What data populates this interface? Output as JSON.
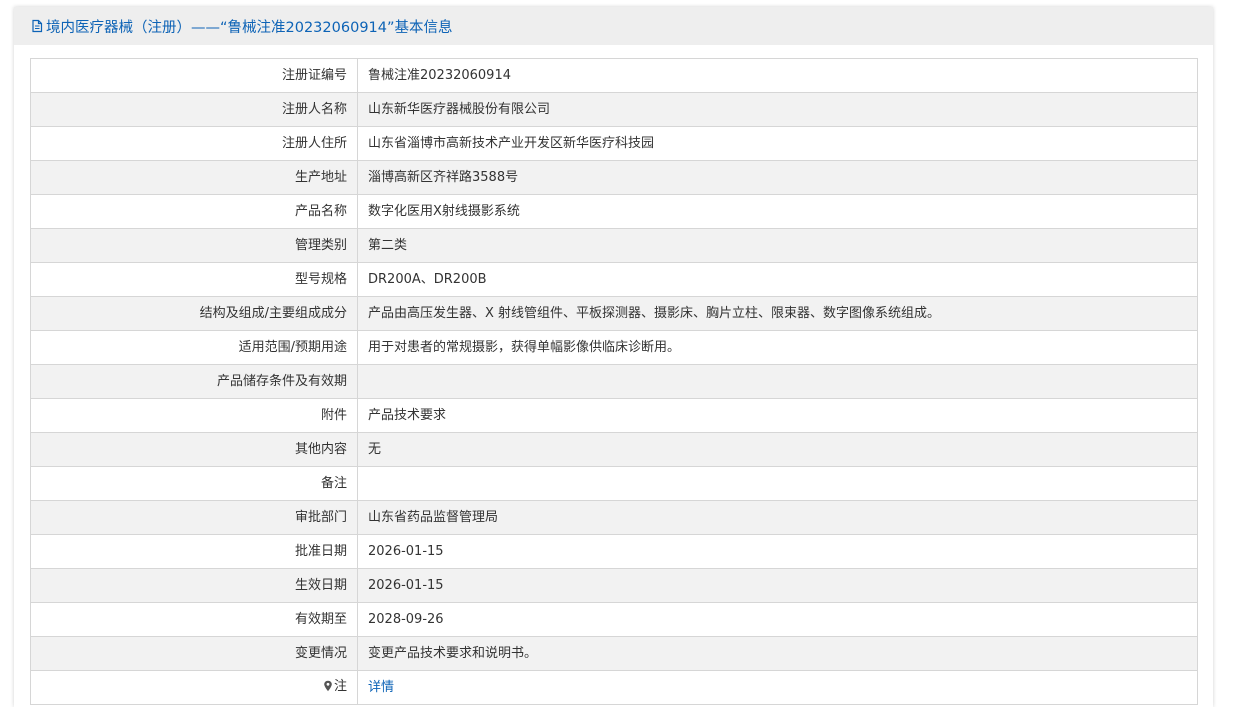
{
  "header": {
    "title": "境内医疗器械（注册）——“鲁械注准20232060914”基本信息",
    "icon": "document-icon"
  },
  "rows": [
    {
      "label": "注册证编号",
      "value": "鲁械注准20232060914"
    },
    {
      "label": "注册人名称",
      "value": "山东新华医疗器械股份有限公司"
    },
    {
      "label": "注册人住所",
      "value": "山东省淄博市高新技术产业开发区新华医疗科技园"
    },
    {
      "label": "生产地址",
      "value": "淄博高新区齐祥路3588号"
    },
    {
      "label": "产品名称",
      "value": "数字化医用X射线摄影系统"
    },
    {
      "label": "管理类别",
      "value": "第二类"
    },
    {
      "label": "型号规格",
      "value": "DR200A、DR200B"
    },
    {
      "label": "结构及组成/主要组成成分",
      "value": "产品由高压发生器、X 射线管组件、平板探测器、摄影床、胸片立柱、限束器、数字图像系统组成。"
    },
    {
      "label": "适用范围/预期用途",
      "value": "用于对患者的常规摄影，获得单幅影像供临床诊断用。"
    },
    {
      "label": "产品储存条件及有效期",
      "value": ""
    },
    {
      "label": "附件",
      "value": "产品技术要求"
    },
    {
      "label": "其他内容",
      "value": "无"
    },
    {
      "label": "备注",
      "value": ""
    },
    {
      "label": "审批部门",
      "value": "山东省药品监督管理局"
    },
    {
      "label": "批准日期",
      "value": "2026-01-15"
    },
    {
      "label": "生效日期",
      "value": "2026-01-15"
    },
    {
      "label": "有效期至",
      "value": "2028-09-26"
    },
    {
      "label": "变更情况",
      "value": "变更产品技术要求和说明书。"
    }
  ],
  "note": {
    "label": "注",
    "link": "详情",
    "icon": "pin-icon"
  },
  "colors": {
    "accent": "#0d63b6",
    "header_bg": "#eeeeee",
    "stripe": "#f2f2f2",
    "border": "#d6d6d6"
  }
}
